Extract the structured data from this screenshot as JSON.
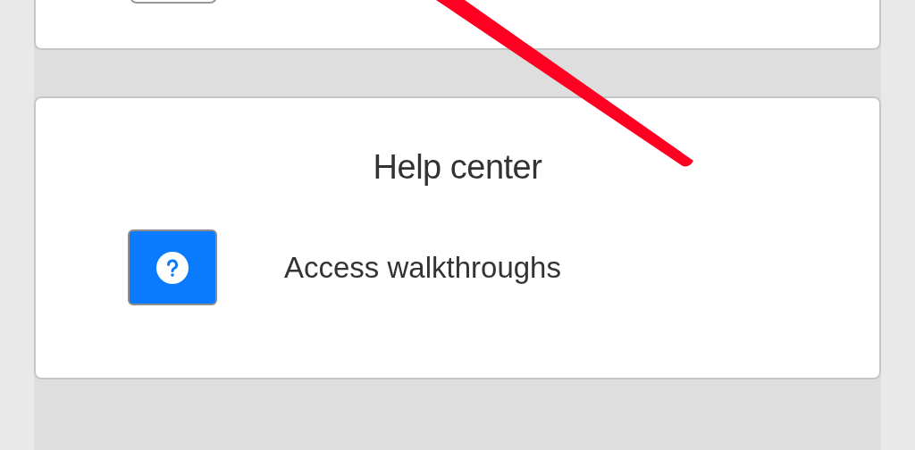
{
  "help_center": {
    "title": "Help center",
    "items": [
      {
        "kind": "help",
        "label": "Access walkthroughs"
      }
    ]
  }
}
